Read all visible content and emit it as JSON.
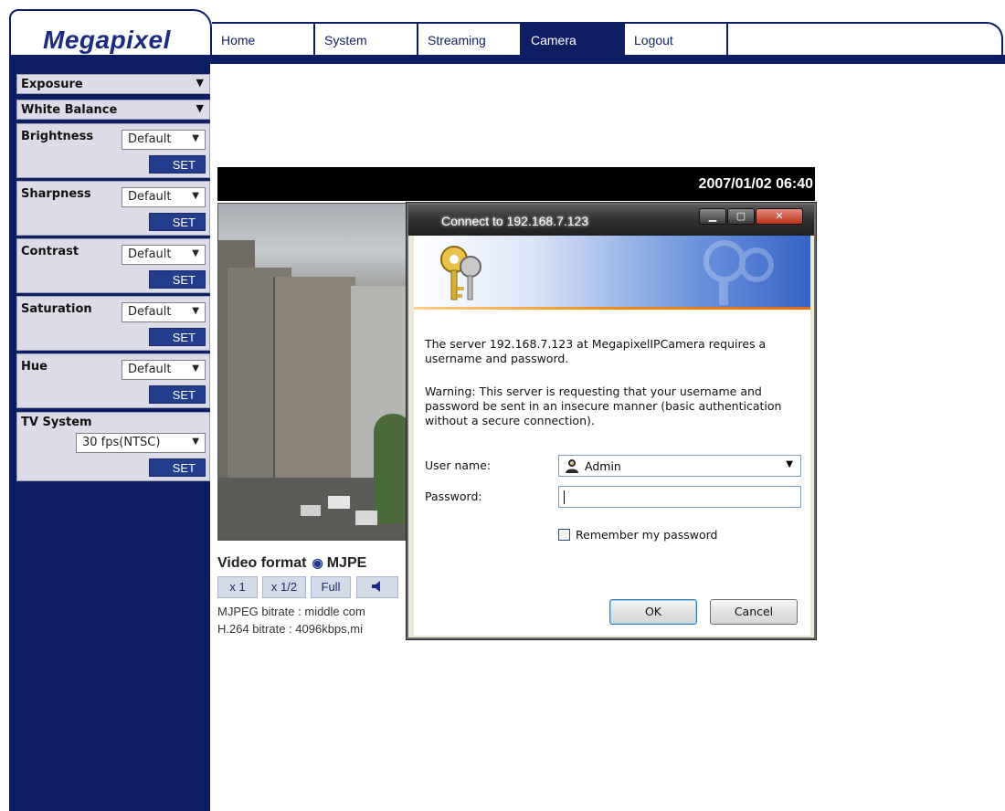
{
  "brand": {
    "logo_text": "Megapixel"
  },
  "nav": {
    "tabs": [
      {
        "label": "Home"
      },
      {
        "label": "System"
      },
      {
        "label": "Streaming"
      },
      {
        "label": "Camera",
        "active": true
      },
      {
        "label": "Logout"
      }
    ]
  },
  "sidebar": {
    "exposure": {
      "label": "Exposure"
    },
    "white_balance": {
      "label": "White Balance"
    },
    "settings": [
      {
        "label": "Brightness",
        "value": "Default",
        "set_label": "SET"
      },
      {
        "label": "Sharpness",
        "value": "Default",
        "set_label": "SET"
      },
      {
        "label": "Contrast",
        "value": "Default",
        "set_label": "SET"
      },
      {
        "label": "Saturation",
        "value": "Default",
        "set_label": "SET"
      },
      {
        "label": "Hue",
        "value": "Default",
        "set_label": "SET"
      }
    ],
    "tv_system": {
      "label": "TV System",
      "value": "30 fps(NTSC)",
      "set_label": "SET"
    }
  },
  "main": {
    "timestamp": "2007/01/02 06:40",
    "video_format_label": "Video format",
    "video_format_option": "MJPE",
    "controls": [
      "x 1",
      "x 1/2",
      "Full"
    ],
    "mjpeg_bitrate": "MJPEG bitrate : middle com",
    "h264_bitrate": "H.264 bitrate : 4096kbps,mi"
  },
  "dialog": {
    "title": "Connect to 192.168.7.123",
    "message": "The server 192.168.7.123 at MegapixelIPCamera requires a username and password.",
    "warning": "Warning: This server is requesting that your username and password be sent in an insecure manner (basic authentication without a secure connection).",
    "username_label": "User name:",
    "username_value": "Admin",
    "password_label": "Password:",
    "remember_label": "Remember my password",
    "ok_label": "OK",
    "cancel_label": "Cancel"
  },
  "colors": {
    "navy": "#0d1e63",
    "panel": "#dcdce8",
    "set_button": "#243c8c"
  }
}
